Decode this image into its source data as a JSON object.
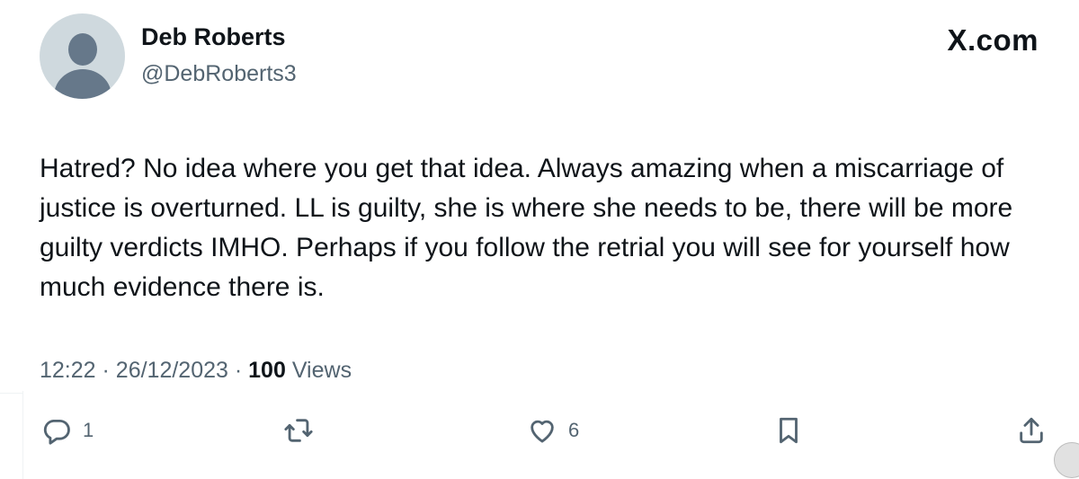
{
  "user": {
    "display_name": "Deb Roberts",
    "handle": "@DebRoberts3",
    "avatar_icon": "default-avatar-icon"
  },
  "brand": "X.com",
  "tweet": {
    "text": "Hatred? No idea where you get that idea. Always amazing when a miscarriage of justice is overturned. LL is guilty, she is where she needs to be, there will be more guilty verdicts IMHO. Perhaps if you follow the retrial you will see for yourself how much evidence there is."
  },
  "meta": {
    "time": "12:22",
    "separator": "·",
    "date": "26/12/2023",
    "views_count": "100",
    "views_label": "Views"
  },
  "actions": {
    "reply": {
      "icon": "reply-icon",
      "count": "1"
    },
    "retweet": {
      "icon": "retweet-icon",
      "count": ""
    },
    "like": {
      "icon": "heart-icon",
      "count": "6"
    },
    "bookmark": {
      "icon": "bookmark-icon"
    },
    "share": {
      "icon": "share-icon"
    }
  },
  "colors": {
    "text": "#0f1419",
    "secondary": "#536471",
    "avatar_bg": "#cfd9de",
    "avatar_fg": "#66788a"
  }
}
